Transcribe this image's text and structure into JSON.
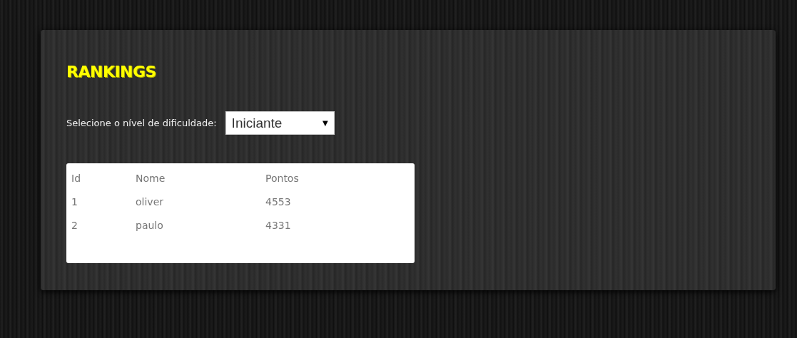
{
  "title": "RANKINGS",
  "difficulty": {
    "label": "Selecione o nível de dificuldade:",
    "value": "Iniciante",
    "arrow": "▼"
  },
  "table": {
    "columns": [
      "Id",
      "Nome",
      "Pontos"
    ],
    "rows": [
      [
        "1",
        "oliver",
        "4553"
      ],
      [
        "2",
        "paulo",
        "4331"
      ]
    ]
  }
}
